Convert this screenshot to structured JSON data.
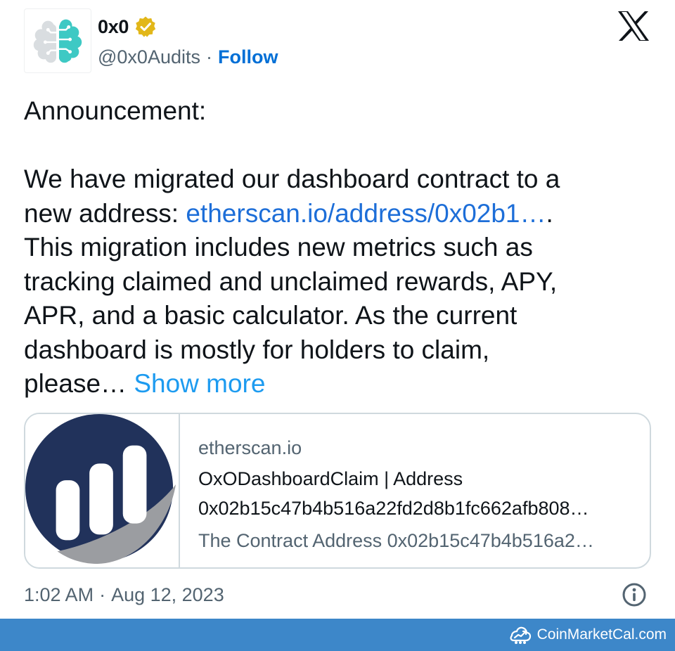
{
  "author": {
    "display_name": "0x0",
    "handle": "@0x0Audits",
    "separator": "·",
    "follow_label": "Follow",
    "avatar_icon": "brain-circuit-logo",
    "verified_icon": "gold-verified-badge"
  },
  "platform_icon": "x-logo",
  "tweet": {
    "line_1": "Announcement:",
    "line_2": "We have migrated our dashboard contract to a",
    "line_3_prefix": "new address: ",
    "line_3_link": "etherscan.io/address/0x02b1…",
    "line_3_suffix": ".",
    "line_4": "This migration includes new metrics such as",
    "line_5": "tracking claimed and unclaimed rewards, APY,",
    "line_6": "APR, and a basic calculator. As the current",
    "line_7": "dashboard is mostly for holders to claim,",
    "line_8_prefix": "please… ",
    "show_more": "Show more"
  },
  "link_card": {
    "domain": "etherscan.io",
    "title_line_1": "OxODashboardClaim | Address",
    "title_line_2": "0x02b15c47b4b516a22fd2d8b1fc662afb808…",
    "description": "The Contract Address 0x02b15c47b4b516a2…",
    "thumbnail_icon": "etherscan-logo"
  },
  "meta": {
    "time": "1:02 AM",
    "separator": "·",
    "date": "Aug 12, 2023",
    "info_icon": "info-icon"
  },
  "footer": {
    "brand": "CoinMarketCal.com",
    "brand_icon": "coinmarketcal-logo"
  },
  "colors": {
    "link_blue": "#1d6ed8",
    "show_more_blue": "#1d9bf0",
    "follow_blue": "#006fd6",
    "text": "#0f1419",
    "muted": "#536471",
    "border": "#cfd9de",
    "footer_bg": "#3d87c9",
    "etherscan_navy": "#21325b",
    "verified_gold": "#e2b719",
    "avatar_teal": "#3ec9c4"
  }
}
